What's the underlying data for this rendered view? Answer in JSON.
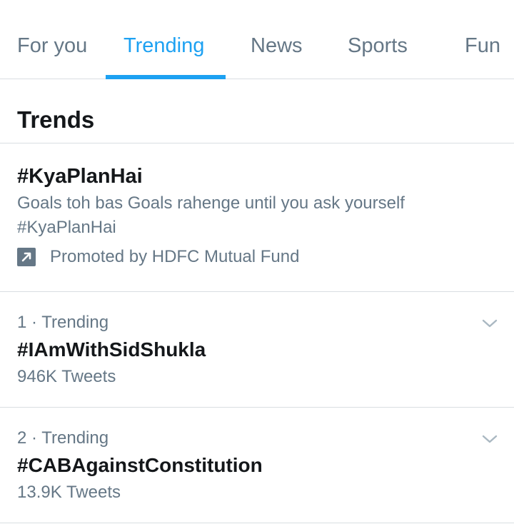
{
  "tabs": [
    {
      "label": "For you",
      "active": false
    },
    {
      "label": "Trending",
      "active": true
    },
    {
      "label": "News",
      "active": false
    },
    {
      "label": "Sports",
      "active": false
    },
    {
      "label": "Fun",
      "active": false
    }
  ],
  "section": {
    "title": "Trends"
  },
  "promoted": {
    "hashtag": "#KyaPlanHai",
    "description": "Goals toh bas Goals rahenge until you ask yourself #KyaPlanHai",
    "promoted_by": "Promoted by HDFC Mutual Fund",
    "icon": "promoted-arrow-icon"
  },
  "trends": [
    {
      "meta": "1 · Trending",
      "name": "#IAmWithSidShukla",
      "count": "946K Tweets"
    },
    {
      "meta": "2 · Trending",
      "name": "#CABAgainstConstitution",
      "count": "13.9K Tweets"
    }
  ],
  "colors": {
    "accent": "#1da1f2",
    "secondary_text": "#657786",
    "primary_text": "#14171a",
    "divider": "#d9dee2"
  }
}
